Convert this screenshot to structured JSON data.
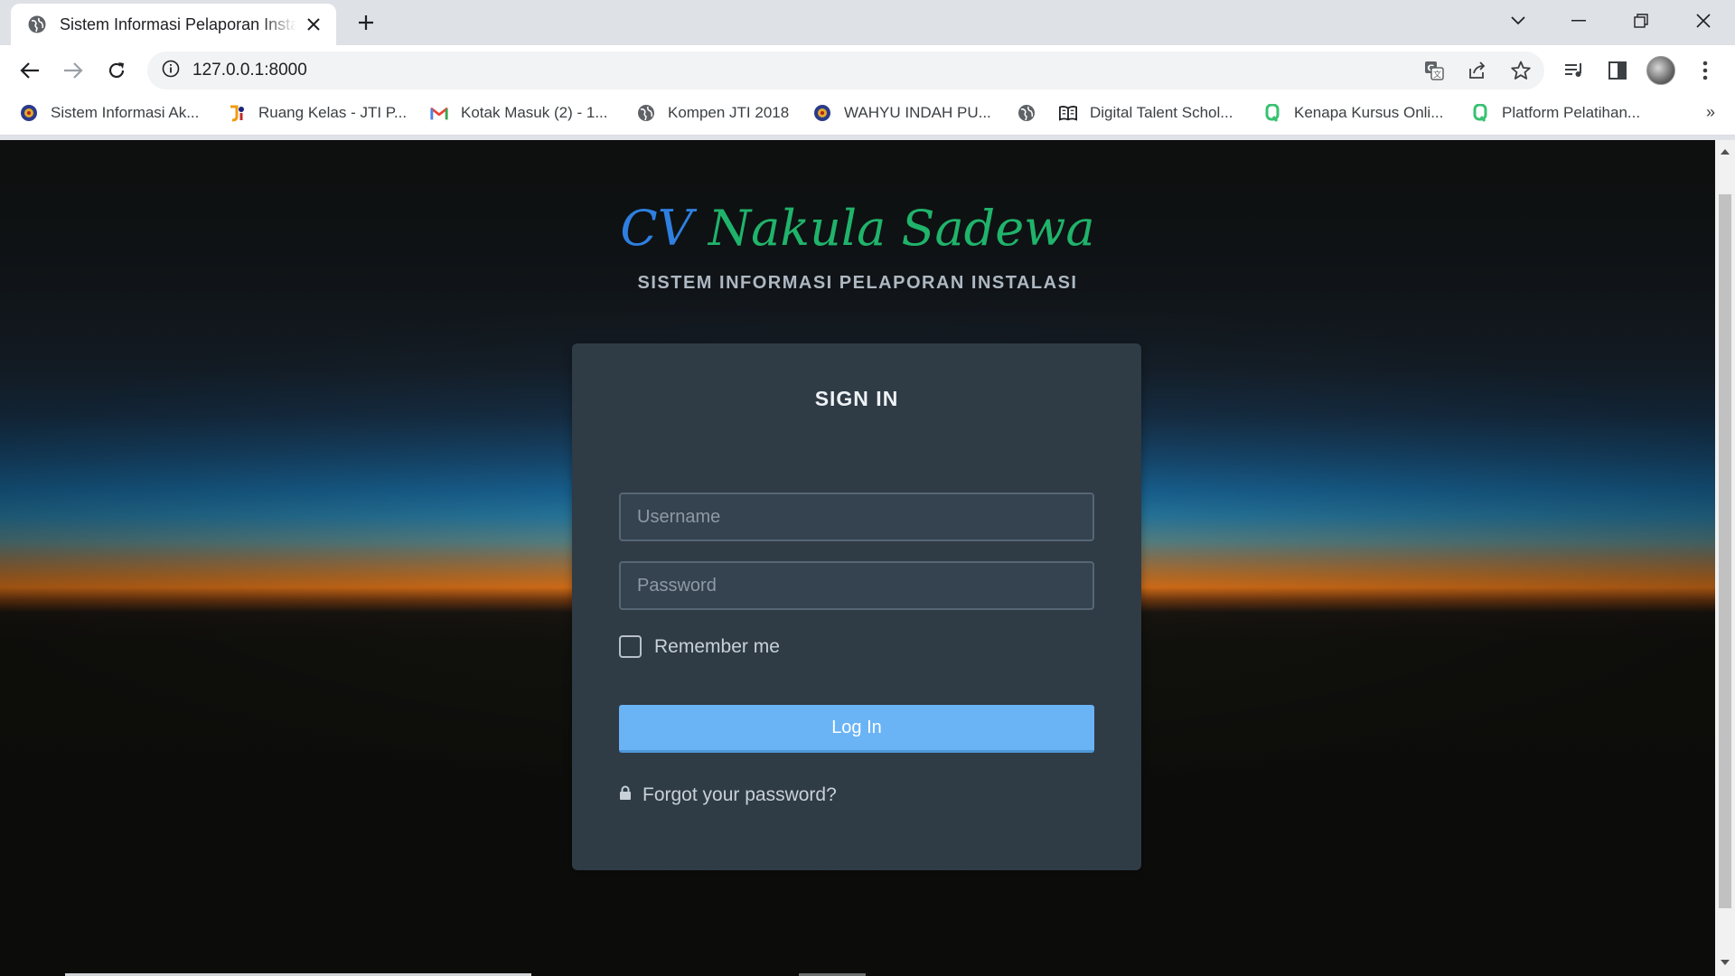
{
  "browser": {
    "tab_title": "Sistem Informasi Pelaporan Instalasi",
    "url": "127.0.0.1:8000",
    "bookmarks": [
      {
        "label": "Sistem Informasi Ak...",
        "icon": "university-seal-icon"
      },
      {
        "label": "Ruang Kelas - JTI P...",
        "icon": "jti-logo-icon"
      },
      {
        "label": "Kotak Masuk (2) - 1...",
        "icon": "gmail-icon"
      },
      {
        "label": "Kompen JTI 2018",
        "icon": "globe-icon"
      },
      {
        "label": "WAHYU INDAH PU...",
        "icon": "university-seal-icon"
      },
      {
        "label": "",
        "icon": "globe-icon"
      },
      {
        "label": "Digital Talent Schol...",
        "icon": "book-icon"
      },
      {
        "label": "Kenapa Kursus Onli...",
        "icon": "course-logo-icon"
      },
      {
        "label": "Platform Pelatihan...",
        "icon": "course-logo-icon"
      }
    ],
    "bookmarks_more": "»"
  },
  "page": {
    "brand_prefix": "CV",
    "brand_name": "Nakula Sadewa",
    "subtitle": "SISTEM INFORMASI PELAPORAN INSTALASI",
    "card_title": "SIGN IN",
    "username_placeholder": "Username",
    "password_placeholder": "Password",
    "remember_label": "Remember me",
    "login_label": "Log In",
    "forgot_label": "Forgot your password?"
  },
  "colors": {
    "brand_prefix": "#2f7fe0",
    "brand_name": "#20b36b",
    "card_bg": "#2f3b45",
    "login_button": "#6ab4f6"
  }
}
